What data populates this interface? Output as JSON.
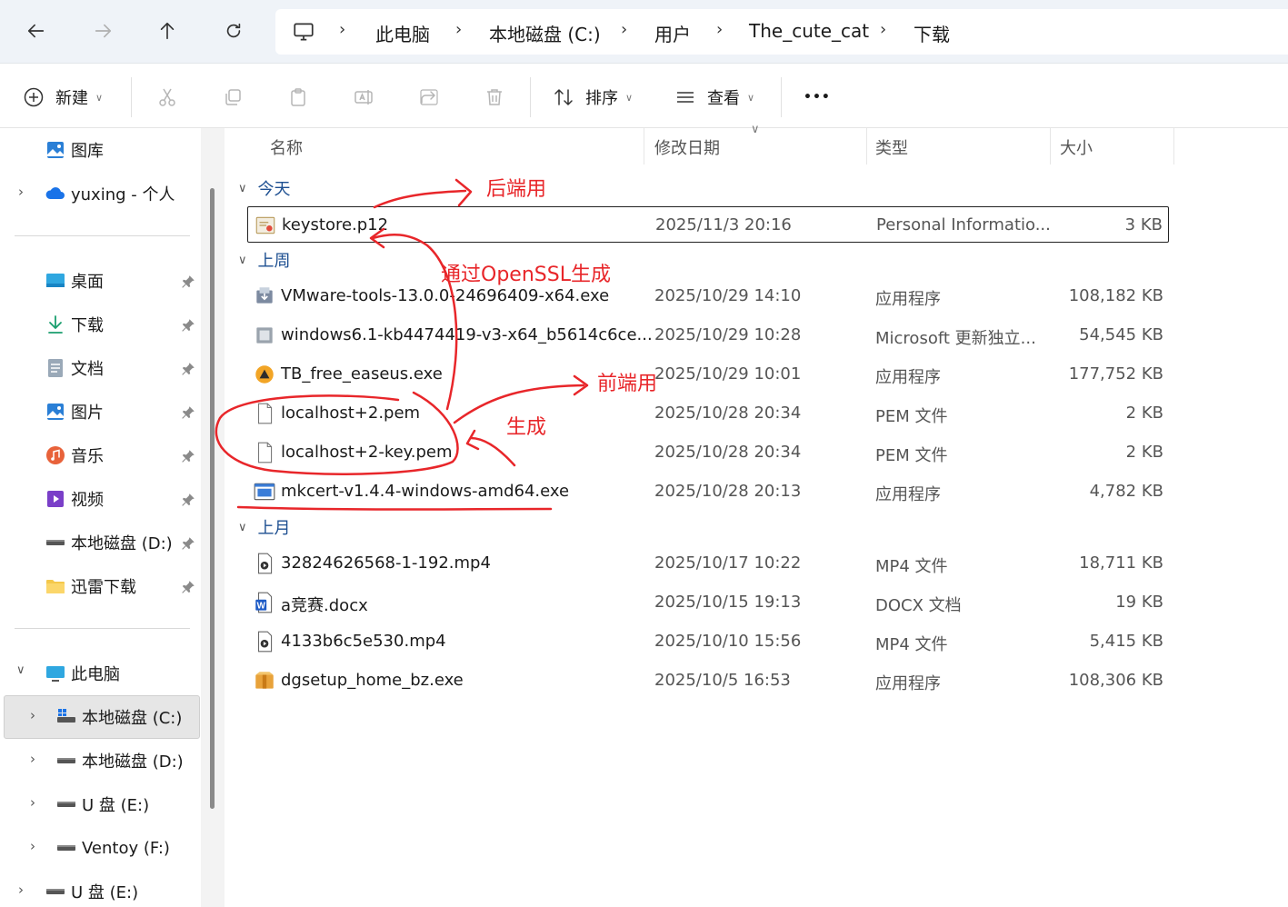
{
  "nav": {
    "breadcrumbs": [
      "此电脑",
      "本地磁盘 (C:)",
      "用户",
      "The_cute_cat",
      "下载"
    ]
  },
  "toolbar": {
    "new_label": "新建",
    "sort_label": "排序",
    "view_label": "查看",
    "more_label": "•••"
  },
  "sidebar": {
    "gallery": "图库",
    "onedrive": "yuxing - 个人",
    "quick": [
      "桌面",
      "下载",
      "文档",
      "图片",
      "音乐",
      "视频",
      "本地磁盘 (D:)",
      "迅雷下载"
    ],
    "this_pc": "此电脑",
    "drives": [
      "本地磁盘 (C:)",
      "本地磁盘 (D:)",
      "U 盘 (E:)",
      "Ventoy (F:)"
    ],
    "usb": "U 盘 (E:)"
  },
  "columns": {
    "name": "名称",
    "date": "修改日期",
    "type": "类型",
    "size": "大小"
  },
  "groups": [
    {
      "label": "今天",
      "files": [
        {
          "name": "keystore.p12",
          "date": "2025/11/3 20:16",
          "type": "Personal Informatio...",
          "size": "3 KB",
          "icon": "certificate-icon"
        }
      ]
    },
    {
      "label": "上周",
      "files": [
        {
          "name": "VMware-tools-13.0.0-24696409-x64.exe",
          "date": "2025/10/29 14:10",
          "type": "应用程序",
          "size": "108,182 KB",
          "icon": "installer-icon"
        },
        {
          "name": "windows6.1-kb4474419-v3-x64_b5614c6ce...",
          "date": "2025/10/29 10:28",
          "type": "Microsoft 更新独立...",
          "size": "54,545 KB",
          "icon": "update-package-icon"
        },
        {
          "name": "TB_free_easeus.exe",
          "date": "2025/10/29 10:01",
          "type": "应用程序",
          "size": "177,752 KB",
          "icon": "app-icon"
        },
        {
          "name": "localhost+2.pem",
          "date": "2025/10/28 20:34",
          "type": "PEM 文件",
          "size": "2 KB",
          "icon": "blank-file-icon"
        },
        {
          "name": "localhost+2-key.pem",
          "date": "2025/10/28 20:34",
          "type": "PEM 文件",
          "size": "2 KB",
          "icon": "blank-file-icon"
        },
        {
          "name": "mkcert-v1.4.4-windows-amd64.exe",
          "date": "2025/10/28 20:13",
          "type": "应用程序",
          "size": "4,782 KB",
          "icon": "exe-icon"
        }
      ]
    },
    {
      "label": "上月",
      "files": [
        {
          "name": "32824626568-1-192.mp4",
          "date": "2025/10/17 10:22",
          "type": "MP4 文件",
          "size": "18,711 KB",
          "icon": "video-file-icon"
        },
        {
          "name": "a竞赛.docx",
          "date": "2025/10/15 19:13",
          "type": "DOCX 文档",
          "size": "19 KB",
          "icon": "word-doc-icon"
        },
        {
          "name": "4133b6c5e530.mp4",
          "date": "2025/10/10 15:56",
          "type": "MP4 文件",
          "size": "5,415 KB",
          "icon": "video-file-icon"
        },
        {
          "name": "dgsetup_home_bz.exe",
          "date": "2025/10/5 16:53",
          "type": "应用程序",
          "size": "108,306 KB",
          "icon": "installer-box-icon"
        }
      ]
    }
  ],
  "annotations": {
    "backend": "后端用",
    "openssl": "通过OpenSSL生成",
    "frontend": "前端用",
    "generate": "生成"
  },
  "colors": {
    "annotation": "#e8262a",
    "nav_bg": "#eff3f8",
    "group_label": "#1d4f91",
    "selection": "#e6e6e6"
  }
}
